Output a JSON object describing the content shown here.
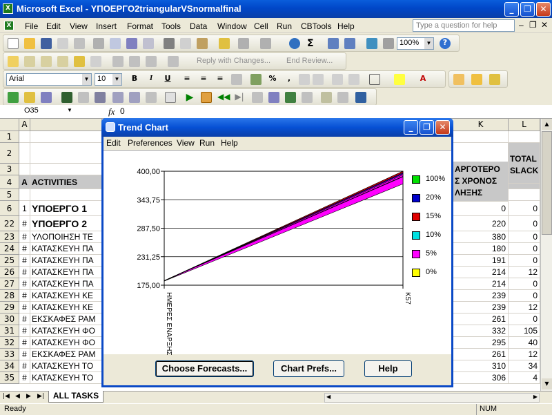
{
  "window": {
    "title": "Microsoft Excel - ΥΠΟΕΡΓΟ2triangularVSnormalfinal"
  },
  "menu": {
    "items": [
      "File",
      "Edit",
      "View",
      "Insert",
      "Format",
      "Tools",
      "Data",
      "Window",
      "Cell",
      "Run",
      "CBTools",
      "Help"
    ],
    "help_placeholder": "Type a question for help"
  },
  "toolbar": {
    "zoom": "100%",
    "reply_label": "Reply with Changes...",
    "end_review_label": "End Review...",
    "font_name": "Arial",
    "font_size": "10"
  },
  "formula_bar": {
    "cell_ref": "O35",
    "fx": "fx",
    "value": "0"
  },
  "sheet": {
    "columns": [
      "A",
      "K",
      "L"
    ],
    "header_K": "ΑΡΓΟΤΕΡΟ Σ ΧΡΟΝΟΣ ΛΗΞΗΣ",
    "header_L": "TOTAL SLACK",
    "activities_label": "ACTIVITIES",
    "rows": [
      {
        "n": "1",
        "a": "",
        "b": "",
        "k": "",
        "l": ""
      },
      {
        "n": "2",
        "a": "",
        "b": "",
        "k": "",
        "l": ""
      },
      {
        "n": "3",
        "a": "",
        "b": "",
        "k": "",
        "l": ""
      },
      {
        "n": "4",
        "a": "A",
        "b": "ACTIVITIES",
        "k": "",
        "l": ""
      },
      {
        "n": "5",
        "a": "",
        "b": "",
        "k": "",
        "l": ""
      },
      {
        "n": "6",
        "a": "1",
        "b": "ΥΠΟΕΡΓΟ 1",
        "k": "0",
        "l": "0"
      },
      {
        "n": "22",
        "a": "#",
        "b": "ΥΠΟΕΡΓΟ 2",
        "k": "220",
        "l": "0"
      },
      {
        "n": "23",
        "a": "#",
        "b": "ΥΛΟΠΟΙΗΣΗ ΤΕ",
        "k": "380",
        "l": "0"
      },
      {
        "n": "24",
        "a": "#",
        "b": "ΚΑΤΑΣΚΕΥΗ ΠΑ",
        "k": "180",
        "l": "0"
      },
      {
        "n": "25",
        "a": "#",
        "b": "ΚΑΤΑΣΚΕΥΗ ΠΑ",
        "k": "191",
        "l": "0"
      },
      {
        "n": "26",
        "a": "#",
        "b": "ΚΑΤΑΣΚΕΥΗ ΠΑ",
        "k": "214",
        "l": "12"
      },
      {
        "n": "27",
        "a": "#",
        "b": "ΚΑΤΑΣΚΕΥΗ ΠΑ",
        "k": "214",
        "l": "0"
      },
      {
        "n": "28",
        "a": "#",
        "b": "ΚΑΤΑΣΚΕΥΗ ΚΕ",
        "k": "239",
        "l": "0"
      },
      {
        "n": "29",
        "a": "#",
        "b": "ΚΑΤΑΣΚΕΥΗ ΚΕ",
        "k": "239",
        "l": "12"
      },
      {
        "n": "30",
        "a": "#",
        "b": "ΕΚΣΚΑΦΕΣ ΡΑΜ",
        "k": "261",
        "l": "0"
      },
      {
        "n": "31",
        "a": "#",
        "b": "ΚΑΤΑΣΚΕΥΗ ΦΟ",
        "k": "332",
        "l": "105"
      },
      {
        "n": "32",
        "a": "#",
        "b": "ΚΑΤΑΣΚΕΥΗ ΦΟ",
        "k": "295",
        "l": "40"
      },
      {
        "n": "33",
        "a": "#",
        "b": "ΕΚΣΚΑΦΕΣ ΡΑΜ",
        "k": "261",
        "l": "12"
      },
      {
        "n": "34",
        "a": "#",
        "b": "ΚΑΤΑΣΚΕΥΗ ΤΟ",
        "k": "310",
        "l": "34"
      },
      {
        "n": "35",
        "a": "#",
        "b": "ΚΑΤΑΣΚΕΥΗ ΤΟ",
        "k": "306",
        "l": "4"
      }
    ],
    "tab_name": "ALL TASKS"
  },
  "status": {
    "left": "Ready",
    "num": "NUM"
  },
  "dialog": {
    "title": "Trend Chart",
    "menu": [
      "Edit",
      "Preferences",
      "View",
      "Run",
      "Help"
    ],
    "buttons": {
      "forecasts": "Choose Forecasts...",
      "prefs": "Chart Prefs...",
      "help": "Help"
    }
  },
  "chart_data": {
    "type": "area",
    "ylim": [
      175,
      400
    ],
    "yticks": [
      "400,00",
      "343,75",
      "287,50",
      "231,25",
      "175,00"
    ],
    "x_labels": [
      "ΗΜΕΡΕΣ ΕΝΑΡΞΗΣ",
      "K57"
    ],
    "series": [
      {
        "name": "100%",
        "color": "#00e000",
        "start": [
          183,
          183
        ],
        "end": [
          400,
          400
        ]
      },
      {
        "name": "20%",
        "color": "#0000cc",
        "start": [
          184,
          184
        ],
        "end": [
          395,
          398
        ]
      },
      {
        "name": "15%",
        "color": "#e00000",
        "start": [
          184,
          184
        ],
        "end": [
          397,
          400
        ]
      },
      {
        "name": "10%",
        "color": "#00e0e0",
        "start": [
          184,
          184
        ],
        "end": [
          389,
          390
        ]
      },
      {
        "name": "5%",
        "color": "#ff00ff",
        "start": [
          183,
          183
        ],
        "end": [
          375,
          400
        ]
      },
      {
        "name": "0%",
        "color": "#ffff00",
        "start": [
          184,
          184
        ],
        "end": [
          393,
          393
        ]
      }
    ]
  }
}
